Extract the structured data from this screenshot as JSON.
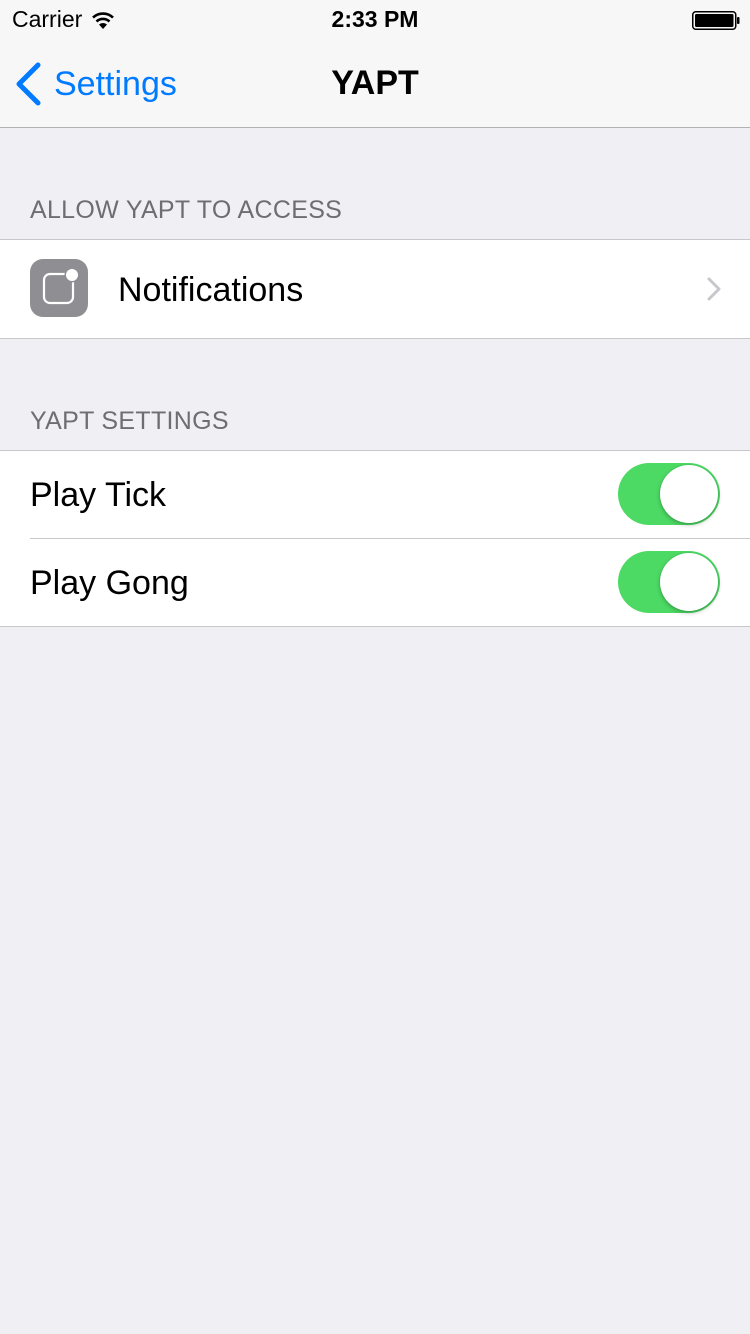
{
  "status_bar": {
    "carrier": "Carrier",
    "time": "2:33 PM",
    "wifi_icon": "wifi-icon",
    "battery_icon": "battery-full-icon"
  },
  "nav": {
    "back_label": "Settings",
    "title": "YAPT",
    "accent_color": "#007aff"
  },
  "sections": [
    {
      "header": "ALLOW YAPT TO ACCESS",
      "rows": [
        {
          "label": "Notifications",
          "icon": "notifications-icon",
          "accessory": "chevron-right-icon"
        }
      ]
    },
    {
      "header": "YAPT SETTINGS",
      "rows": [
        {
          "label": "Play Tick",
          "toggle_on": true
        },
        {
          "label": "Play Gong",
          "toggle_on": true
        }
      ]
    }
  ],
  "colors": {
    "toggle_on": "#4cd964",
    "background": "#efeff4"
  }
}
